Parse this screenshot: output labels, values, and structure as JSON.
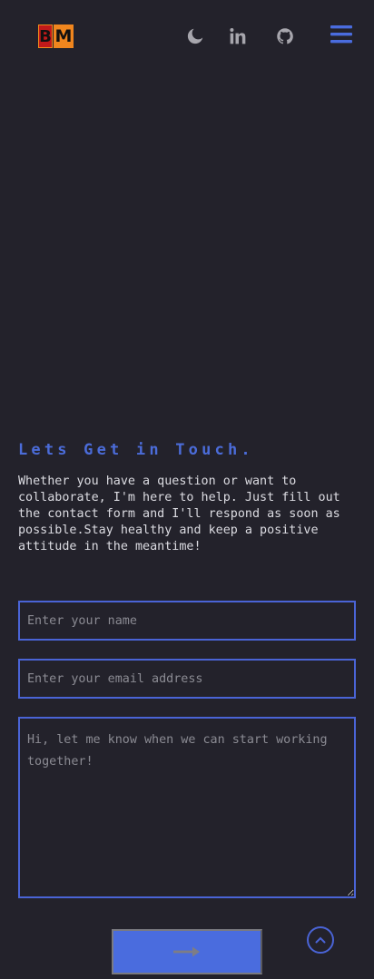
{
  "header": {
    "logo": {
      "letter1": "B",
      "letter2": "M"
    },
    "icons": [
      "moon-icon",
      "linkedin-icon",
      "github-icon",
      "hamburger-menu-icon"
    ]
  },
  "contact": {
    "title": "Lets Get in Touch.",
    "intro": "Whether you have a question or want to collaborate, I'm here to help. Just fill out the contact form and I'll respond as soon as possible.Stay healthy and keep a positive attitude in the meantime!",
    "name_placeholder": "Enter your name",
    "email_placeholder": "Enter your email address",
    "message_placeholder": "Hi, let me know when we can start working together!",
    "submit_icon": "arrow-right-icon"
  },
  "colors": {
    "background": "#23222b",
    "accent": "#4a64d6",
    "button": "#4a6cde",
    "text": "#dcdce2"
  }
}
